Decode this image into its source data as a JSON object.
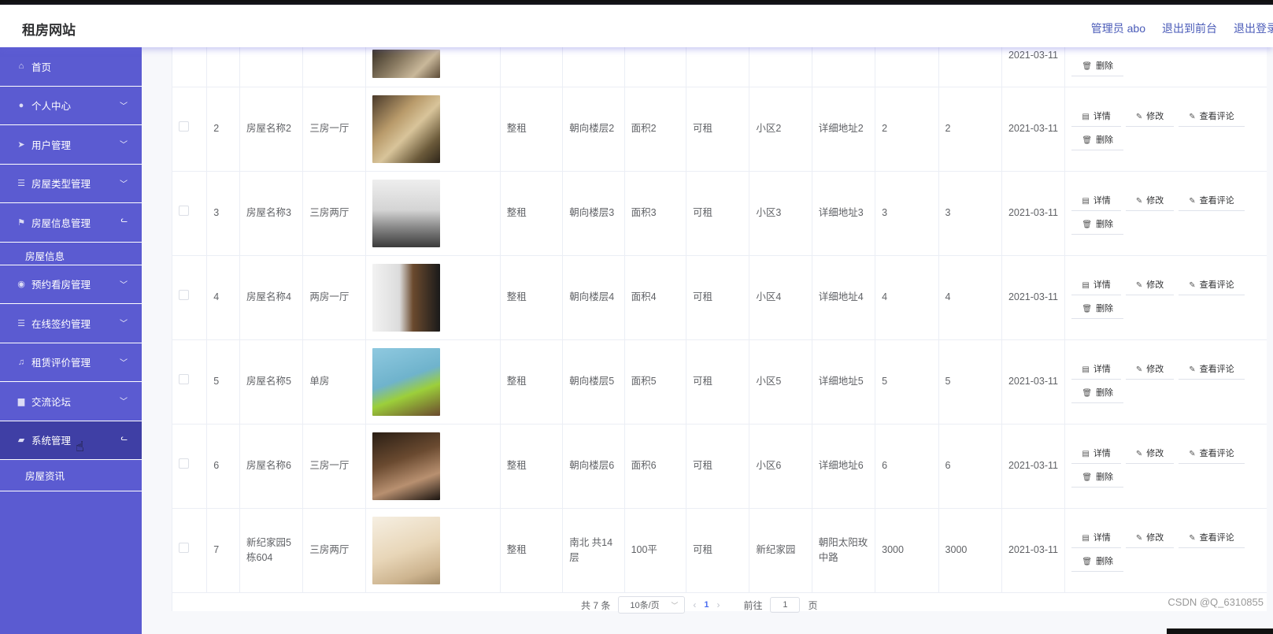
{
  "header": {
    "site_title": "租房网站",
    "admin_label": "管理员 abo",
    "front_link": "退出到前台",
    "logout_link": "退出登录"
  },
  "sidebar": {
    "items": [
      {
        "label": "首页",
        "icon": "home-icon"
      },
      {
        "label": "个人中心",
        "icon": "user-icon"
      },
      {
        "label": "用户管理",
        "icon": "send-icon"
      },
      {
        "label": "房屋类型管理",
        "icon": "list-icon"
      },
      {
        "label": "房屋信息管理",
        "icon": "flag-icon"
      },
      {
        "label": "房屋信息"
      },
      {
        "label": "预约看房管理",
        "icon": "bulb-icon"
      },
      {
        "label": "在线签约管理",
        "icon": "list-icon"
      },
      {
        "label": "租赁评价管理",
        "icon": "bell-icon"
      },
      {
        "label": "交流论坛",
        "icon": "monitor-icon"
      },
      {
        "label": "系统管理",
        "icon": "suitcase-icon"
      },
      {
        "label": "房屋资讯"
      }
    ]
  },
  "actions": {
    "detail": "详情",
    "edit": "修改",
    "comments": "查看评论",
    "delete": "删除"
  },
  "rows": [
    {
      "id": "2",
      "name": "房屋名称2",
      "layout": "三房一厅",
      "rent_type": "整租",
      "floor": "朝向楼层2",
      "area": "面积2",
      "status": "可租",
      "community": "小区2",
      "address": "详细地址2",
      "price": "2",
      "deposit": "2",
      "date": "2021-03-11"
    },
    {
      "id": "3",
      "name": "房屋名称3",
      "layout": "三房两厅",
      "rent_type": "整租",
      "floor": "朝向楼层3",
      "area": "面积3",
      "status": "可租",
      "community": "小区3",
      "address": "详细地址3",
      "price": "3",
      "deposit": "3",
      "date": "2021-03-11"
    },
    {
      "id": "4",
      "name": "房屋名称4",
      "layout": "两房一厅",
      "rent_type": "整租",
      "floor": "朝向楼层4",
      "area": "面积4",
      "status": "可租",
      "community": "小区4",
      "address": "详细地址4",
      "price": "4",
      "deposit": "4",
      "date": "2021-03-11"
    },
    {
      "id": "5",
      "name": "房屋名称5",
      "layout": "单房",
      "rent_type": "整租",
      "floor": "朝向楼层5",
      "area": "面积5",
      "status": "可租",
      "community": "小区5",
      "address": "详细地址5",
      "price": "5",
      "deposit": "5",
      "date": "2021-03-11"
    },
    {
      "id": "6",
      "name": "房屋名称6",
      "layout": "三房一厅",
      "rent_type": "整租",
      "floor": "朝向楼层6",
      "area": "面积6",
      "status": "可租",
      "community": "小区6",
      "address": "详细地址6",
      "price": "6",
      "deposit": "6",
      "date": "2021-03-11"
    },
    {
      "id": "7",
      "name": "新纪家园5栋604",
      "layout": "三房两厅",
      "rent_type": "整租",
      "floor": "南北 共14层",
      "area": "100平",
      "status": "可租",
      "community": "新纪家园",
      "address": "朝阳太阳玫中路",
      "price": "3000",
      "deposit": "3000",
      "date": "2021-03-11"
    }
  ],
  "first_row": {
    "date": "2021-03-11"
  },
  "pagination": {
    "total": "共 7 条",
    "page_size": "10条/页",
    "current": "1",
    "goto_label": "前往",
    "goto_value": "1",
    "page_suffix": "页"
  },
  "watermark": "CSDN @Q_6310855",
  "colors": {
    "sidebar_bg": "#5b5bd1",
    "sidebar_active": "#3f3fa5",
    "link": "#4a5bb8"
  }
}
